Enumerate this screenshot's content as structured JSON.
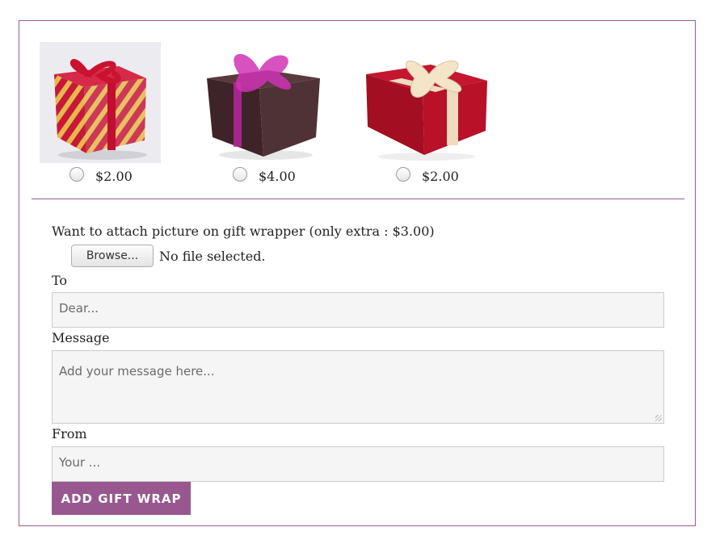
{
  "gift_wraps": [
    {
      "price": "$2.00",
      "icon": "gift-box-red-yellow-stripes-icon"
    },
    {
      "price": "$4.00",
      "icon": "gift-box-brown-pink-ribbon-icon"
    },
    {
      "price": "$2.00",
      "icon": "gift-box-red-cream-ribbon-icon"
    }
  ],
  "attach": {
    "label": "Want to attach picture on gift wrapper (only extra : $3.00)",
    "browse_label": "Browse...",
    "file_status": "No file selected."
  },
  "form": {
    "to_label": "To",
    "to_placeholder": "Dear...",
    "message_label": "Message",
    "message_placeholder": "Add your message here...",
    "from_label": "From",
    "from_placeholder": "Your ...",
    "submit_label": "ADD GIFT WRAP"
  },
  "colors": {
    "accent": "#98588f",
    "border": "#9c5a94",
    "field_bg": "#f5f5f5"
  }
}
